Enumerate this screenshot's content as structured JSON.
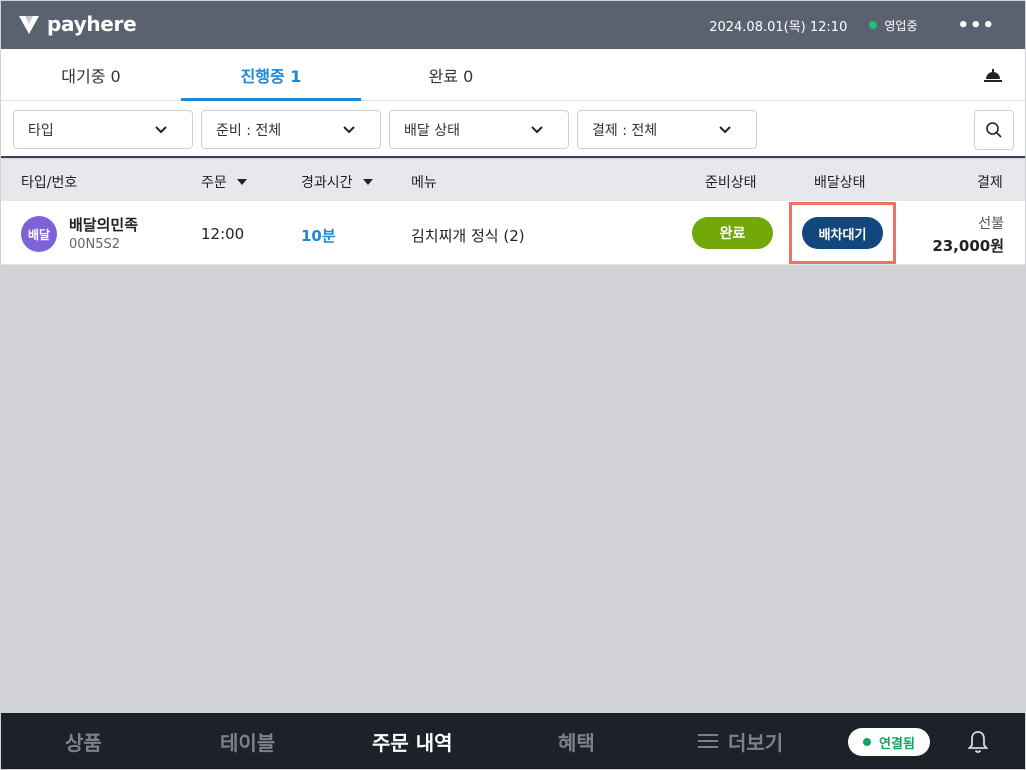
{
  "header": {
    "logo_text": "payhere",
    "datetime": "2024.08.01(목) 12:10",
    "status_text": "영업중",
    "more_icon": "more-icon"
  },
  "tabs": [
    {
      "label": "대기중 0",
      "active": false
    },
    {
      "label": "진행중 1",
      "active": true
    },
    {
      "label": "완료 0",
      "active": false
    }
  ],
  "filters": [
    {
      "label": "타입"
    },
    {
      "label": "준비 : 전체"
    },
    {
      "label": "배달 상태"
    },
    {
      "label": "결제 : 전체"
    }
  ],
  "table": {
    "columns": [
      "타입/번호",
      "주문",
      "경과시간",
      "메뉴",
      "준비상태",
      "배달상태",
      "결제"
    ],
    "rows": [
      {
        "type_badge": "배달",
        "store": "배달의민족",
        "order_no": "00N5S2",
        "order_time": "12:00",
        "elapsed": "10분",
        "menu": "김치찌개 정식 (2)",
        "prep_status": "완료",
        "delivery_status": "배차대기",
        "payment_type": "선불",
        "payment_amount": "23,000원"
      }
    ]
  },
  "bottom_nav": {
    "items": [
      "상품",
      "테이블",
      "주문 내역",
      "혜택",
      "더보기"
    ],
    "connection": "연결됨"
  },
  "colors": {
    "header_bg": "#5b626f",
    "accent": "#1b88d8",
    "prep_done": "#72a80a",
    "delivery_wait": "#12477e",
    "highlight": "#ee7366",
    "bottom_bg": "#1d2129"
  }
}
